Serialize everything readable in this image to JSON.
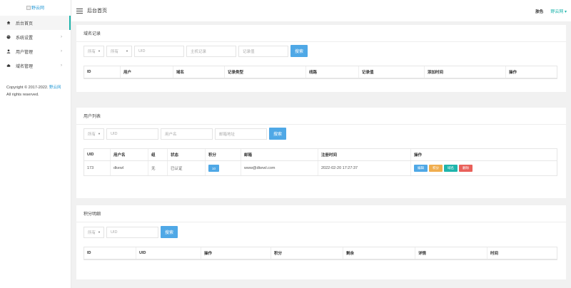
{
  "sidebar": {
    "logo_alt": "野云网",
    "items": [
      {
        "label": "后台首页",
        "icon": "home-icon",
        "active": true,
        "arrow": ""
      },
      {
        "label": "系统设置",
        "icon": "palette-icon",
        "active": false,
        "arrow": "›"
      },
      {
        "label": "用户管理",
        "icon": "user-icon",
        "active": false,
        "arrow": "›"
      },
      {
        "label": "域名管理",
        "icon": "cloud-icon",
        "active": false,
        "arrow": "›"
      }
    ],
    "copyright_line1": "Copyright © 2017-2022.",
    "copyright_link": "野云网",
    "copyright_line2": "All rights reserved."
  },
  "topbar": {
    "title": "后台首页",
    "skin": "肤色",
    "user": "野云网 ▾"
  },
  "domain_panel": {
    "title": "域名记录",
    "filter1": "所有",
    "filter2": "所有",
    "uid_placeholder": "UID",
    "host_placeholder": "主机记录",
    "value_placeholder": "记录值",
    "search": "搜索",
    "columns": [
      "ID",
      "用户",
      "域名",
      "记录类型",
      "线路",
      "记录值",
      "添加时间",
      "操作"
    ]
  },
  "user_panel": {
    "title": "用户列表",
    "filter1": "所有",
    "uid_placeholder": "UID",
    "name_placeholder": "用户名",
    "email_placeholder": "邮箱地址",
    "search": "搜索",
    "columns": [
      "UID",
      "用户名",
      "组",
      "状态",
      "积分",
      "邮箱",
      "注册时间",
      "操作"
    ],
    "rows": [
      {
        "uid": "173",
        "name": "dkewl",
        "group": "无",
        "status": "已认证",
        "points": "10",
        "email": "www@dkewl.com",
        "reg_time": "2022-02-20 17:27:37",
        "actions": [
          "编辑",
          "积分",
          "域名",
          "删除"
        ]
      }
    ]
  },
  "points_panel": {
    "title": "积分明细",
    "filter1": "所有",
    "uid_placeholder": "UID",
    "search": "搜索",
    "columns": [
      "ID",
      "UID",
      "操作",
      "积分",
      "剩余",
      "详情",
      "时间"
    ]
  },
  "colors": {
    "accent": "#1fb5ac",
    "primary": "#4fa8e6",
    "warning": "#f0ad4e",
    "danger": "#e9605a"
  }
}
